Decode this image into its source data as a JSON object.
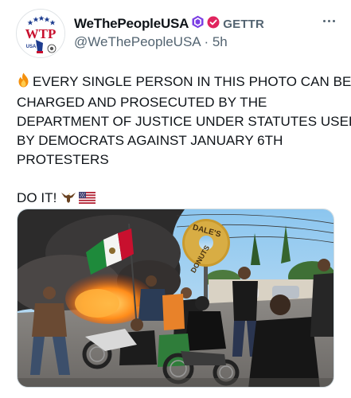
{
  "post": {
    "author": {
      "display_name": "WeThePeopleUSA",
      "platform_label": "GETTR",
      "handle": "@WeThePeopleUSA",
      "separator": "·",
      "timestamp": "5h",
      "avatar_text": "WTP",
      "avatar_subtext": "USA"
    },
    "text_lines": [
      "EVERY SINGLE PERSON IN THIS PHOTO CAN BE",
      "CHARGED AND PROSECUTED BY THE",
      "DEPARTMENT OF JUSTICE UNDER STATUTES USED",
      "BY DEMOCRATS AGAINST JANUARY 6TH",
      "PROTESTERS"
    ],
    "call_to_action": "DO IT!",
    "photo": {
      "sign_text_top": "DALE'S",
      "sign_text_bottom": "DONUTS"
    }
  },
  "icons": {
    "fire": "fire-icon",
    "eagle": "eagle-icon",
    "flag": "us-flag-icon",
    "hexagon_badge": "hexagon-badge-icon",
    "verified_badge": "verified-badge-icon",
    "more": "more-options-icon"
  },
  "colors": {
    "text_primary": "#0f1419",
    "text_secondary": "#536471",
    "badge_purple": "#7b3fe4",
    "badge_red": "#e0245e",
    "avatar_red": "#c8102e",
    "avatar_blue": "#1d3c8f"
  }
}
